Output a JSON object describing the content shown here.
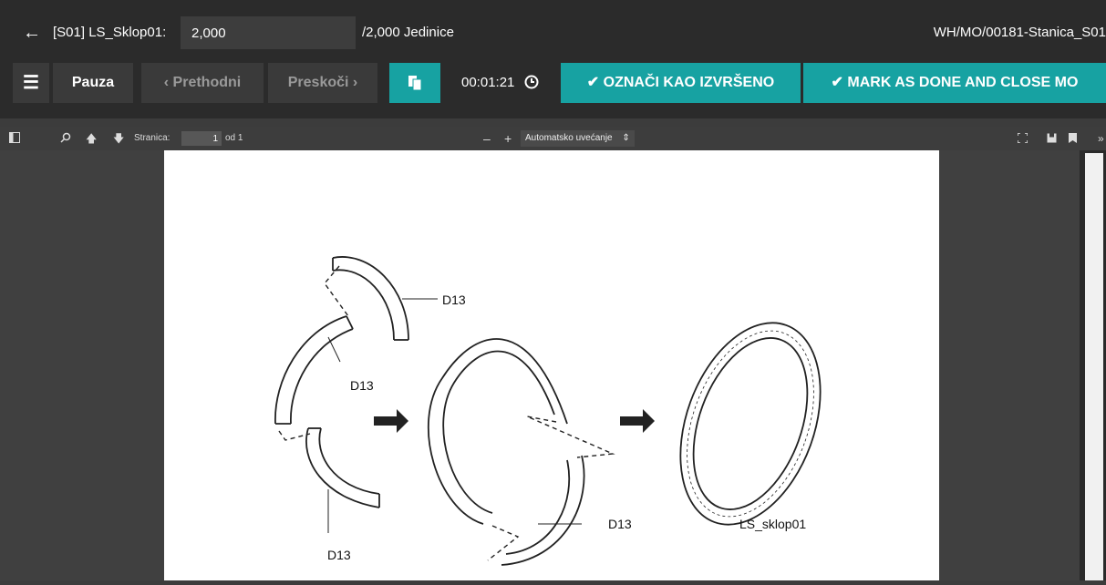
{
  "header": {
    "step_title": "[S01] LS_Sklop01:",
    "quantity_value": "2,000",
    "quantity_unit": "/2,000 Jedinice",
    "mo_reference": "WH/MO/00181-Stanica_S01"
  },
  "actions": {
    "pause_label": "Pauza",
    "previous_label": "‹ Prethodni",
    "skip_label": "Preskoči ›",
    "timer": "00:01:21",
    "mark_done_label": "✔ OZNAČI KAO IZVRŠENO",
    "mark_done_close_label": "✔ MARK AS DONE AND CLOSE MO"
  },
  "viewer": {
    "page_label": "Stranica:",
    "page_number": "1",
    "page_total": "od 1",
    "zoom_label": "Automatsko uvećanje"
  },
  "drawing": {
    "labels": [
      "D13",
      "D13",
      "D13",
      "D13"
    ],
    "result_label": "LS_sklop01"
  },
  "colors": {
    "accent": "#17a2a2",
    "topbar": "#2b2b2b",
    "viewer_bg": "#404040"
  }
}
